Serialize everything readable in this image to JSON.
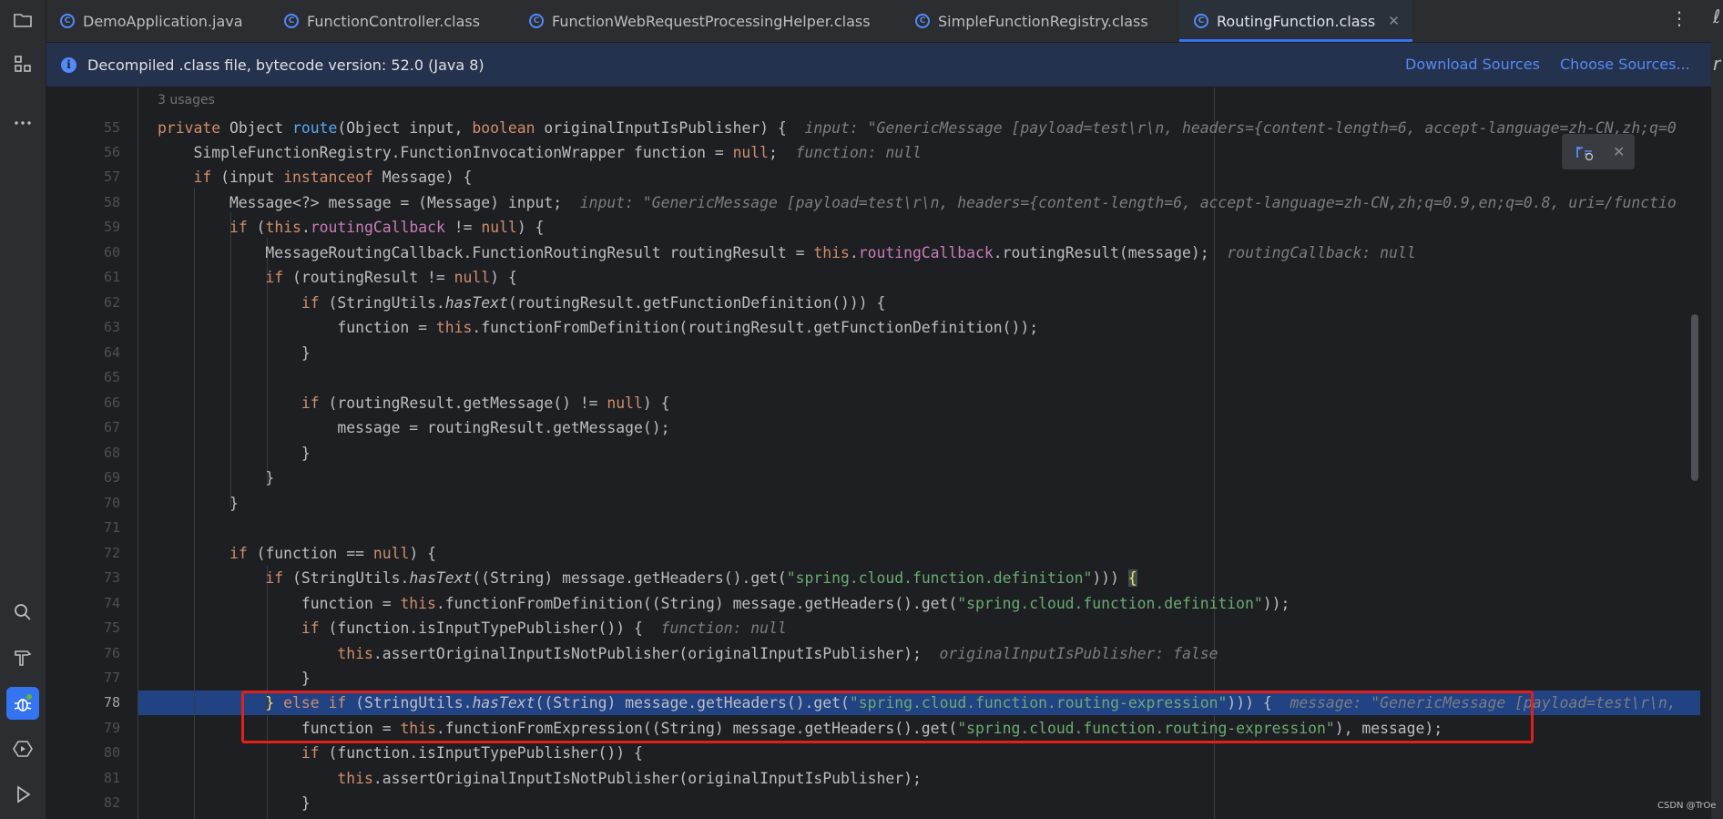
{
  "tabs": [
    {
      "label": "DemoApplication.java",
      "icon": "class-icon",
      "active": false
    },
    {
      "label": "FunctionController.class",
      "icon": "class-icon",
      "active": false
    },
    {
      "label": "FunctionWebRequestProcessingHelper.class",
      "icon": "class-icon",
      "active": false
    },
    {
      "label": "SimpleFunctionRegistry.class",
      "icon": "class-icon",
      "active": false
    },
    {
      "label": "RoutingFunction.class",
      "icon": "class-icon",
      "active": true,
      "close": "✕"
    }
  ],
  "tab_menu": "⋮",
  "banner": {
    "message": "Decompiled .class file, bytecode version: 52.0 (Java 8)",
    "download_sources": "Download Sources",
    "choose_sources": "Choose Sources..."
  },
  "editor": {
    "usages": "3 usages",
    "current_line": 78,
    "lines": [
      {
        "n": "55",
        "t": "private Object route(Object input, boolean originalInputIsPublisher) {"
      },
      {
        "n": "56",
        "t": "SimpleFunctionRegistry.FunctionInvocationWrapper function = null;"
      },
      {
        "n": "57",
        "t": "if (input instanceof Message) {"
      },
      {
        "n": "58",
        "t": "Message<?> message = (Message) input;"
      },
      {
        "n": "59",
        "t": "if (this.routingCallback != null) {"
      },
      {
        "n": "60",
        "t": "MessageRoutingCallback.FunctionRoutingResult routingResult = this.routingCallback.routingResult(message);"
      },
      {
        "n": "61",
        "t": "if (routingResult != null) {"
      },
      {
        "n": "62",
        "t": "if (StringUtils.hasText(routingResult.getFunctionDefinition())) {"
      },
      {
        "n": "63",
        "t": "function = this.functionFromDefinition(routingResult.getFunctionDefinition());"
      },
      {
        "n": "64",
        "t": "}"
      },
      {
        "n": "65",
        "t": ""
      },
      {
        "n": "66",
        "t": "if (routingResult.getMessage() != null) {"
      },
      {
        "n": "67",
        "t": "message = routingResult.getMessage();"
      },
      {
        "n": "68",
        "t": "}"
      },
      {
        "n": "69",
        "t": "}"
      },
      {
        "n": "70",
        "t": "}"
      },
      {
        "n": "71",
        "t": ""
      },
      {
        "n": "72",
        "t": "if (function == null) {"
      },
      {
        "n": "73",
        "t": "if (StringUtils.hasText((String) message.getHeaders().get(\"spring.cloud.function.definition\"))) {"
      },
      {
        "n": "74",
        "t": "function = this.functionFromDefinition((String) message.getHeaders().get(\"spring.cloud.function.definition\"));"
      },
      {
        "n": "75",
        "t": "if (function.isInputTypePublisher()) {"
      },
      {
        "n": "76",
        "t": "this.assertOriginalInputIsNotPublisher(originalInputIsPublisher);"
      },
      {
        "n": "77",
        "t": "}"
      },
      {
        "n": "78",
        "t": "} else if (StringUtils.hasText((String) message.getHeaders().get(\"spring.cloud.function.routing-expression\"))) {"
      },
      {
        "n": "79",
        "t": "function = this.functionFromExpression((String) message.getHeaders().get(\"spring.cloud.function.routing-expression\"), message);"
      },
      {
        "n": "80",
        "t": "if (function.isInputTypePublisher()) {"
      },
      {
        "n": "81",
        "t": "this.assertOriginalInputIsNotPublisher(originalInputIsPublisher);"
      },
      {
        "n": "82",
        "t": "}"
      }
    ],
    "hints": {
      "h55": "input: \"GenericMessage [payload=test\\r\\n, headers={content-length=6, accept-language=zh-CN,zh;q=0",
      "h56": "function: null",
      "h58": "input: \"GenericMessage [payload=test\\r\\n, headers={content-length=6, accept-language=zh-CN,zh;q=0.9,en;q=0.8, uri=/functio",
      "h60": "routingCallback: null",
      "h75": "function: null",
      "h76": "originalInputIsPublisher: false",
      "h78": "message: \"GenericMessage [payload=test\\r\\n,"
    }
  },
  "right_strip_glyphs": [
    "ℓ",
    "r"
  ],
  "float_toolbar": {
    "close": "✕"
  },
  "watermark": "CSDN @TrOe",
  "colors": {
    "accent": "#3574f0",
    "keyword": "#cf8e6d",
    "method": "#56a8f5",
    "field": "#c77dbb",
    "string": "#6aab73",
    "highlight_box": "#e0201b",
    "current_line_bg": "#214283"
  }
}
